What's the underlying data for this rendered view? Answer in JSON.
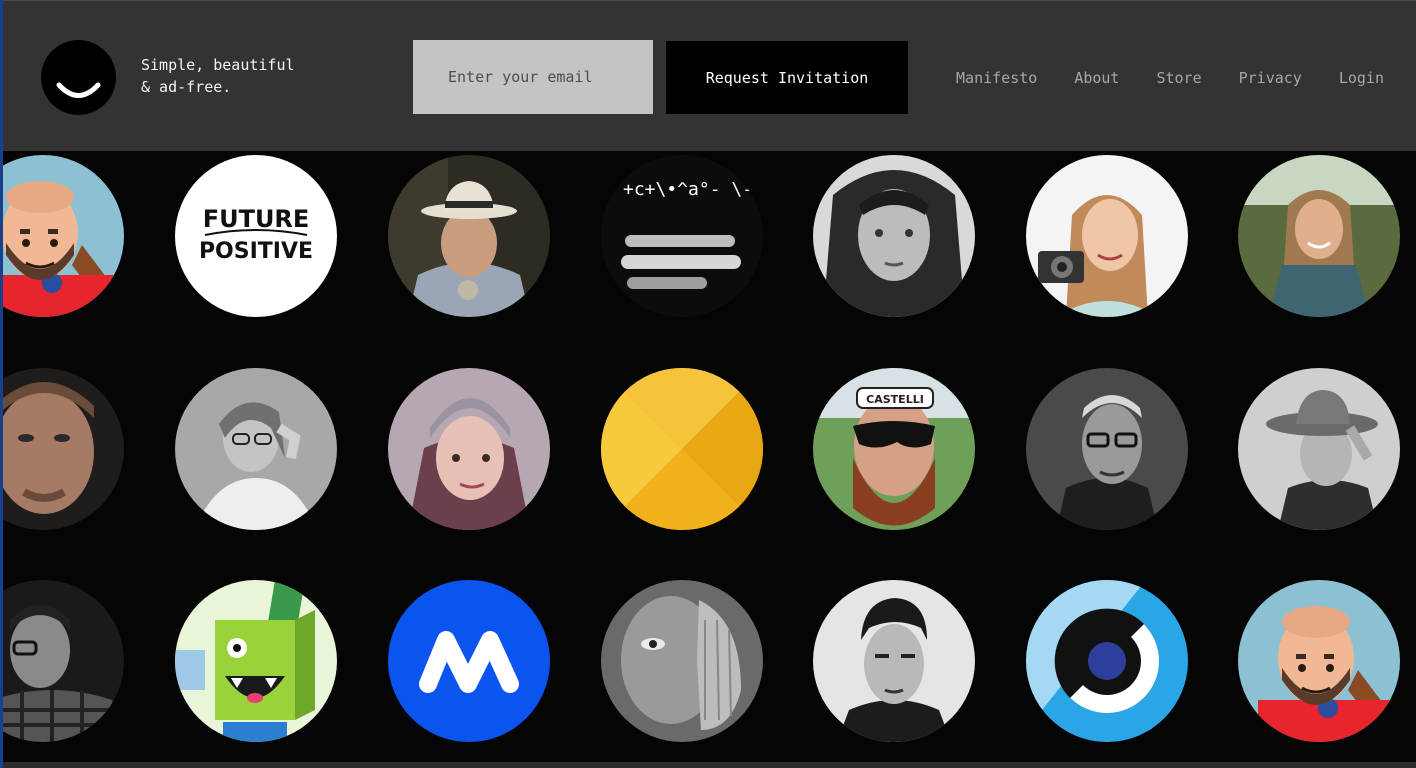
{
  "header": {
    "tagline": "Simple, beautiful\n& ad-free.",
    "email_placeholder": "Enter your email",
    "request_label": "Request Invitation",
    "background": "#333333"
  },
  "nav": {
    "items": [
      {
        "label": "Manifesto"
      },
      {
        "label": "About"
      },
      {
        "label": "Store"
      },
      {
        "label": "Privacy"
      },
      {
        "label": "Login"
      }
    ]
  },
  "avatar_badges": {
    "future_positive_line1": "FUTURE",
    "future_positive_line2": "POSITIVE",
    "castelli": "CASTELLI",
    "handwriting": "+c+\\•^a°- \\-nt•et^•"
  },
  "colors": {
    "brand_black": "#000000",
    "input_gray": "#c4c4c4",
    "nav_text": "#a8a8a8",
    "grid_background": "#050505",
    "avatar_yellow": "#f3b71b",
    "avatar_blue": "#0a55f0",
    "avatar_sky": "#2aa5e6"
  }
}
